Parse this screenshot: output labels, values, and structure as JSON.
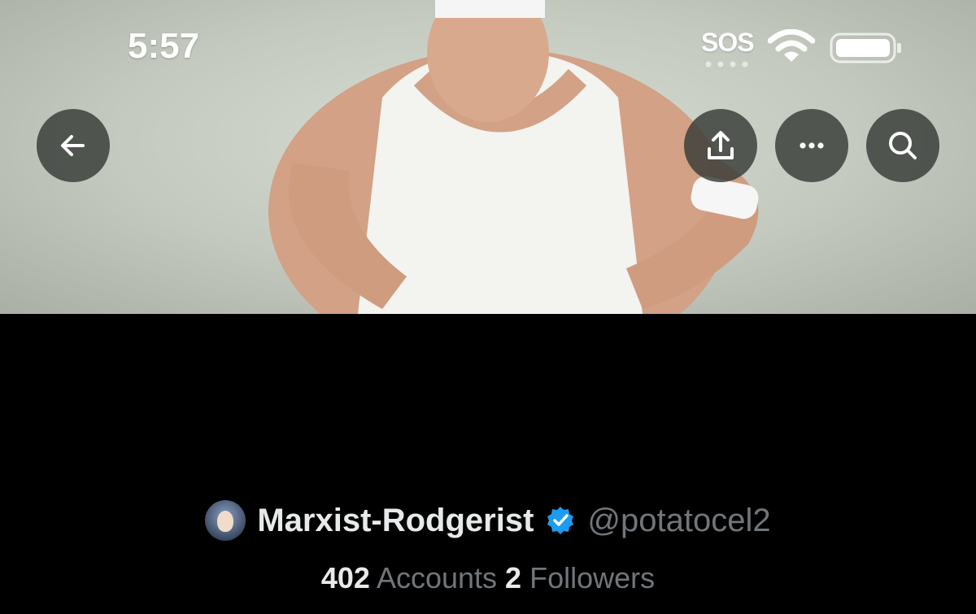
{
  "status_bar": {
    "time": "5:57",
    "sos_label": "SOS",
    "icons": [
      "wifi-icon",
      "battery-icon"
    ]
  },
  "banner": {
    "toolbar_icons": [
      "back-arrow-icon",
      "share-icon",
      "more-icon",
      "search-icon"
    ]
  },
  "list": {
    "title": "",
    "description": "",
    "owner": {
      "display_name": "Marxist-Rodgerist",
      "handle": "@potatocel2",
      "verified": true
    },
    "stats": {
      "accounts_count": "402",
      "accounts_label": "Accounts",
      "followers_count": "2",
      "followers_label": "Followers"
    }
  },
  "colors": {
    "background": "#000000",
    "primary_text": "#e7e9ea",
    "secondary_text": "#71767b",
    "verified_blue": "#1d9bf0",
    "button_overlay": "#373a37"
  }
}
